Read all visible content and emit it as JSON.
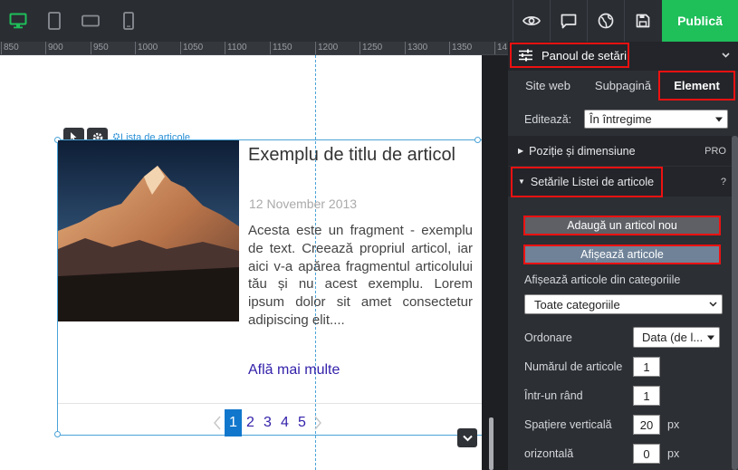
{
  "toolbar": {
    "devices": [
      "desktop-icon",
      "tablet-icon",
      "tablet-landscape-icon",
      "mobile-icon"
    ],
    "actions": [
      "preview-icon",
      "comments-icon",
      "globe-icon",
      "save-icon"
    ],
    "publish_label": "Publică",
    "accent": "#1fbf5a"
  },
  "ruler": {
    "ticks": [
      "850",
      "900",
      "950",
      "1000",
      "1050",
      "1100",
      "1150",
      "1200",
      "1250",
      "1300",
      "1350",
      "14"
    ]
  },
  "widget": {
    "label": "Lista de articole"
  },
  "article": {
    "title": "Exemplu de titlu de articol",
    "date": "12 November 2013",
    "excerpt": "Acesta este un fragment - exemplu de text. Creează propriul articol, iar aici v-a apărea fragmentul articolului tău și nu acest exemplu. Lorem ipsum dolor sit amet consectetur adipiscing elit....",
    "more_link": "Află mai multe"
  },
  "pagination": {
    "pages": [
      "1",
      "2",
      "3",
      "4",
      "5"
    ],
    "active": "1"
  },
  "panel": {
    "title": "Panoul de setări",
    "tabs": [
      "Site web",
      "Subpagină",
      "Element"
    ],
    "active_tab": "Element",
    "edit_label": "Editează:",
    "edit_value": "În întregime",
    "section_position": "Poziție și dimensiune",
    "section_position_badge": "PRO",
    "section_list": "Setările Listei de articole",
    "section_list_help": "?",
    "add_article_button": "Adaugă un articol nou",
    "show_articles_button": "Afișează articole",
    "category_label": "Afișează articole din categoriile",
    "category_value": "Toate categoriile",
    "order_label": "Ordonare",
    "order_value": "Data (de l...",
    "count_label": "Numărul de articole",
    "count_value": "1",
    "per_row_label": "Într-un rând",
    "per_row_value": "1",
    "vspace_label": "Spațiere verticală",
    "vspace_value": "20",
    "hspace_label": "orizontală",
    "hspace_value": "0",
    "unit": "px"
  }
}
